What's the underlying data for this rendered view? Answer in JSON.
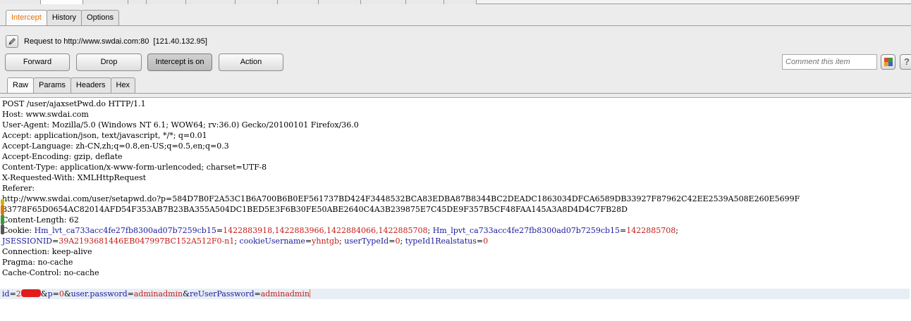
{
  "top_tabs": {
    "count": 12
  },
  "tabs": {
    "intercept": "Intercept",
    "history": "History",
    "options": "Options",
    "active": "Intercept"
  },
  "request_label": "Request to http://www.swdai.com:80  [121.40.132.95]",
  "buttons": {
    "forward": "Forward",
    "drop": "Drop",
    "intercept_on": "Intercept is on",
    "action": "Action"
  },
  "comment": {
    "placeholder": "Comment this item"
  },
  "help_icon": "?",
  "view_tabs": {
    "raw": "Raw",
    "params": "Params",
    "headers": "Headers",
    "hex": "Hex",
    "active": "Raw"
  },
  "request": {
    "request_line": "POST /user/ajaxsetPwd.do HTTP/1.1",
    "host": "Host: www.swdai.com",
    "user_agent": "User-Agent: Mozilla/5.0 (Windows NT 6.1; WOW64; rv:36.0) Gecko/20100101 Firefox/36.0",
    "accept": "Accept: application/json, text/javascript, */*; q=0.01",
    "accept_language": "Accept-Language: zh-CN,zh;q=0.8,en-US;q=0.5,en;q=0.3",
    "accept_encoding": "Accept-Encoding: gzip, deflate",
    "content_type": "Content-Type: application/x-www-form-urlencoded; charset=UTF-8",
    "x_requested_with": "X-Requested-With: XMLHttpRequest",
    "referer": "Referer:",
    "referer_url_1": "http://www.swdai.com/user/setapwd.do?p=584D7B0F2A53C1B6A700B6B0EF561737BD424F3448532BCA83EDBA87B8344BC2DEADC1863034DFCA6589DB33927F87962C42EE2539A508E260E5699F",
    "referer_url_2": "83778F65D0654AC82014AFD54F353AB7B23BA355A504DC1BED5E3F6B30FE50ABE2640C4A3B239875E7C45DE9F357B5CF48FAA145A3A8D4D4C7FB28D",
    "content_length": "Content-Length: 62",
    "cookie_label": "Cookie: ",
    "cookie_1_name": "Hm_lvt_ca733acc4fe27fb8300ad07b7259cb15",
    "cookie_1_value": "1422883918,1422883966,1422884066,1422885708",
    "cookie_2_name": "Hm_lpvt_ca733acc4fe27fb8300ad07b7259cb15",
    "cookie_2_value": "1422885708",
    "cookie_3_name": "JSESSIONID",
    "cookie_3_value": "39A2193681446EB047997BC152A512F0-n1",
    "cookie_4_name": "cookieUsername",
    "cookie_4_value": "yhntgb",
    "cookie_5_name": "userTypeId",
    "cookie_5_value": "0",
    "cookie_6_name": "typeId1Realstatus",
    "cookie_6_value": "0",
    "connection": "Connection: keep-alive",
    "pragma": "Pragma: no-cache",
    "cache_control": "Cache-Control: no-cache",
    "body_p1_name": "id",
    "body_p1_value_visible": "2",
    "body_p2_name": "p",
    "body_p2_value": "0",
    "body_p3_name": "user.password",
    "body_p3_value": "adminadmin",
    "body_p4_name": "reUserPassword",
    "body_p4_value": "adminadmin"
  },
  "colors": {
    "active_tab_text": "#e8750c",
    "param_name": "#1a1a9c",
    "param_value": "#c41a16",
    "redaction": "#e11b1b",
    "caret": "#e07b00"
  }
}
